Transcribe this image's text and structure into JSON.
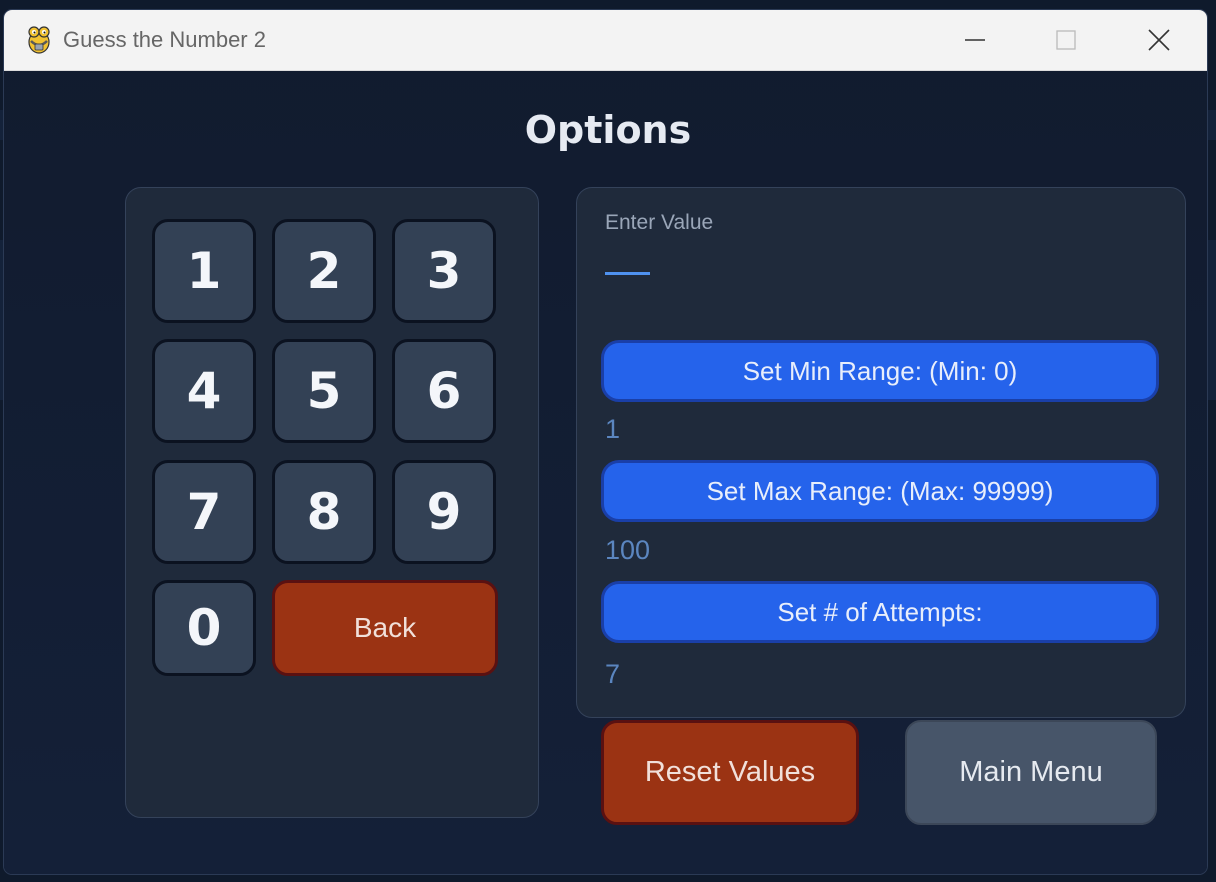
{
  "window": {
    "title": "Guess the Number 2",
    "controls": [
      "minimize-icon",
      "maximize-icon",
      "close-icon"
    ]
  },
  "page": {
    "heading": "Options"
  },
  "keypad": {
    "keys": [
      "1",
      "2",
      "3",
      "4",
      "5",
      "6",
      "7",
      "8",
      "9",
      "0"
    ],
    "back_label": "Back"
  },
  "settings": {
    "enter_label": "Enter Value",
    "min_button": "Set Min Range: (Min: 0)",
    "min_value": "1",
    "max_button": "Set Max Range: (Max: 99999)",
    "max_value": "100",
    "attempts_button": "Set # of Attempts:",
    "attempts_value": "7"
  },
  "actions": {
    "reset_label": "Reset Values",
    "main_menu_label": "Main Menu"
  },
  "colors": {
    "background": "#111b2e",
    "panel": "#1f2a3b",
    "key": "#334155",
    "danger": "#9b3313",
    "primary": "#2563eb",
    "secondary": "#475569",
    "value_text": "#5b86c0"
  }
}
